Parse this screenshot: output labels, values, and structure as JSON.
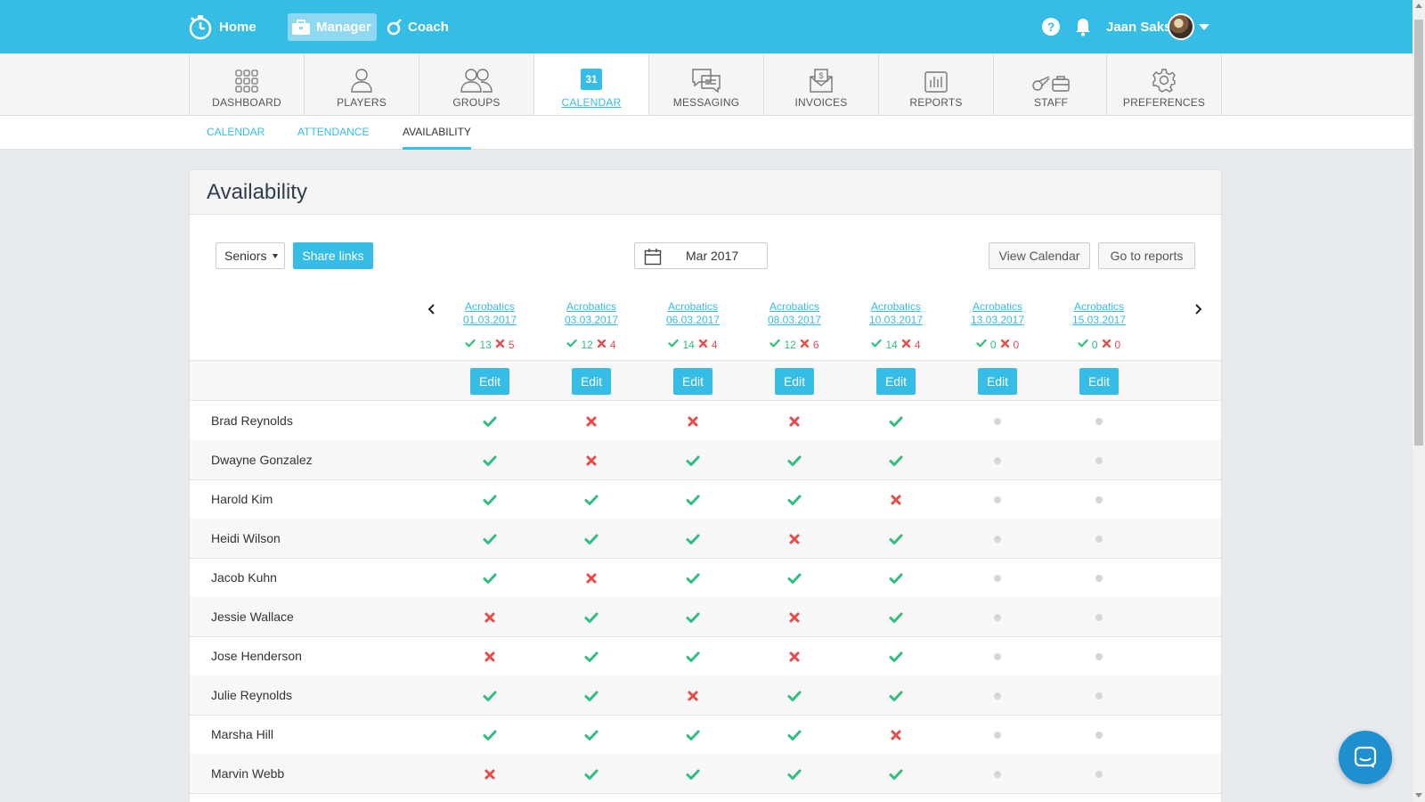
{
  "topbar": {
    "home_label": "Home",
    "manager_label": "Manager",
    "coach_label": "Coach",
    "help_symbol": "?",
    "user_name": "Jaan Saks"
  },
  "nav": [
    {
      "label": "DASHBOARD",
      "icon": "grid-icon"
    },
    {
      "label": "PLAYERS",
      "icon": "person-icon"
    },
    {
      "label": "GROUPS",
      "icon": "group-icon"
    },
    {
      "label": "CALENDAR",
      "icon": "calendar-icon",
      "icon_text": "31",
      "active": true
    },
    {
      "label": "MESSAGING",
      "icon": "chat-icon"
    },
    {
      "label": "INVOICES",
      "icon": "invoice-icon"
    },
    {
      "label": "REPORTS",
      "icon": "chart-icon"
    },
    {
      "label": "STAFF",
      "icon": "whistle-icon"
    },
    {
      "label": "PREFERENCES",
      "icon": "gear-icon"
    }
  ],
  "subnav": [
    {
      "label": "CALENDAR"
    },
    {
      "label": "ATTENDANCE"
    },
    {
      "label": "AVAILABILITY",
      "active": true
    }
  ],
  "page": {
    "title": "Availability",
    "group_select": "Seniors",
    "share_label": "Share links",
    "month": "Mar 2017",
    "view_calendar_label": "View Calendar",
    "go_reports_label": "Go to reports",
    "edit_label": "Edit"
  },
  "events": [
    {
      "name": "Acrobatics",
      "date": "01.03.2017",
      "yes": "13",
      "no": "5"
    },
    {
      "name": "Acrobatics",
      "date": "03.03.2017",
      "yes": "12",
      "no": "4"
    },
    {
      "name": "Acrobatics",
      "date": "06.03.2017",
      "yes": "14",
      "no": "4"
    },
    {
      "name": "Acrobatics",
      "date": "08.03.2017",
      "yes": "12",
      "no": "6"
    },
    {
      "name": "Acrobatics",
      "date": "10.03.2017",
      "yes": "14",
      "no": "4"
    },
    {
      "name": "Acrobatics",
      "date": "13.03.2017",
      "yes": "0",
      "no": "0"
    },
    {
      "name": "Acrobatics",
      "date": "15.03.2017",
      "yes": "0",
      "no": "0"
    }
  ],
  "players": [
    {
      "name": "Brad Reynolds",
      "status": [
        "yes",
        "no",
        "no",
        "no",
        "yes",
        "none",
        "none"
      ]
    },
    {
      "name": "Dwayne Gonzalez",
      "status": [
        "yes",
        "no",
        "yes",
        "yes",
        "yes",
        "none",
        "none"
      ]
    },
    {
      "name": "Harold Kim",
      "status": [
        "yes",
        "yes",
        "yes",
        "yes",
        "no",
        "none",
        "none"
      ]
    },
    {
      "name": "Heidi Wilson",
      "status": [
        "yes",
        "yes",
        "yes",
        "no",
        "yes",
        "none",
        "none"
      ]
    },
    {
      "name": "Jacob Kuhn",
      "status": [
        "yes",
        "no",
        "yes",
        "yes",
        "yes",
        "none",
        "none"
      ]
    },
    {
      "name": "Jessie Wallace",
      "status": [
        "no",
        "yes",
        "yes",
        "no",
        "yes",
        "none",
        "none"
      ]
    },
    {
      "name": "Jose Henderson",
      "status": [
        "no",
        "yes",
        "yes",
        "no",
        "yes",
        "none",
        "none"
      ]
    },
    {
      "name": "Julie Reynolds",
      "status": [
        "yes",
        "yes",
        "no",
        "yes",
        "yes",
        "none",
        "none"
      ]
    },
    {
      "name": "Marsha Hill",
      "status": [
        "yes",
        "yes",
        "yes",
        "yes",
        "no",
        "none",
        "none"
      ]
    },
    {
      "name": "Marvin Webb",
      "status": [
        "no",
        "yes",
        "yes",
        "yes",
        "yes",
        "none",
        "none"
      ]
    }
  ],
  "colors": {
    "accent": "#35bde6",
    "yes": "#2fbf7c",
    "no": "#e84a4a",
    "none": "#d6d6d6"
  }
}
